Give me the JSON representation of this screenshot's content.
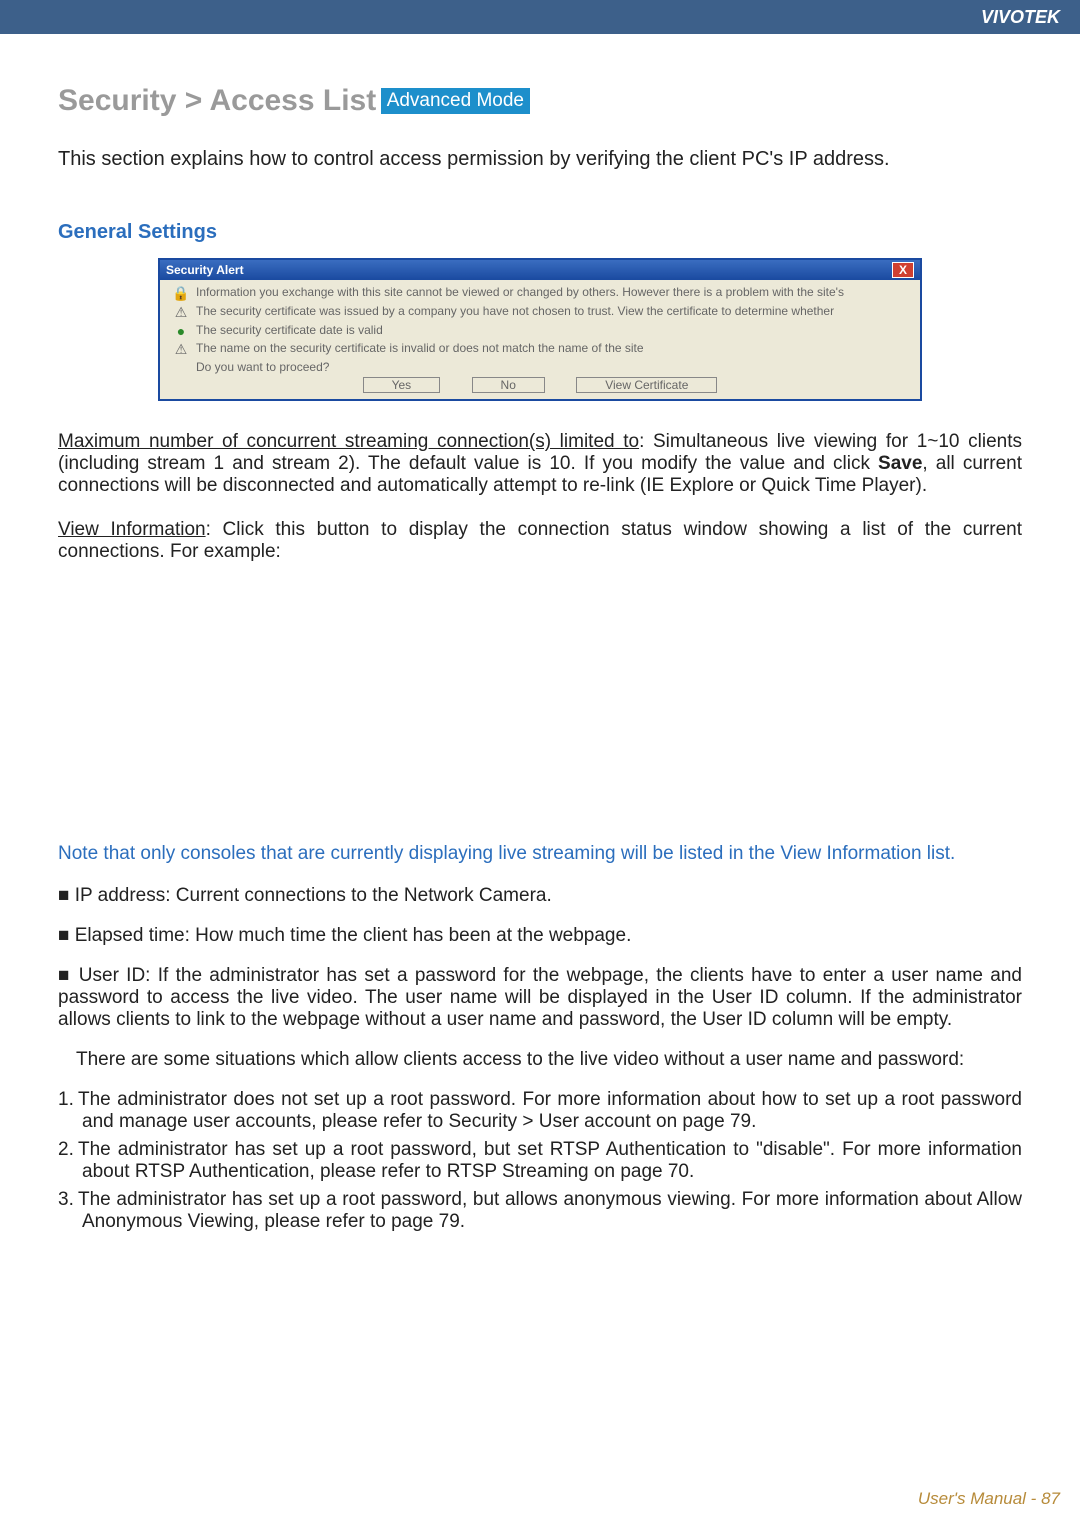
{
  "brand": "VIVOTEK",
  "title_main": "Security  >  Access List",
  "title_badge": "Advanced Mode",
  "intro": "This section explains how to control access permission by verifying the client PC's IP address.",
  "section_general": "General Settings",
  "dialog": {
    "title": "Security Alert",
    "close": "X",
    "line_top": "Information you exchange with this site cannot be viewed or changed by others. However there is a problem with the site's",
    "cert1": "The security certificate was issued by a company you have not chosen to trust. View the certificate to determine whether",
    "cert2": "The security certificate date is valid",
    "cert3": "The name on the security certificate is invalid or does not match the name of the site",
    "prompt": "Do you want to proceed?",
    "btn_yes": "Yes",
    "btn_no": "No",
    "btn_view": "View Certificate"
  },
  "para_max_label": "Maximum number of concurrent streaming connection(s) limited to",
  "para_max_rest": ": Simultaneous live viewing for 1~10 clients (including stream 1 and stream 2). The default value is 10. If you modify the value and click ",
  "para_max_bold": "Save",
  "para_max_tail": ", all current connections will be disconnected and automatically attempt to re-link (IE Explore or Quick Time Player).",
  "para_view_label": "View Information",
  "para_view_rest": ": Click this button to display the connection status window showing a list of the current connections. For example:",
  "note_text": "Note that only consoles that are currently displaying live streaming will be listed in the View Information list.",
  "bul_ip": "■ IP address: Current connections to the Network Camera.",
  "bul_elapsed": "■ Elapsed time: How much time the client has been at the webpage.",
  "bul_user_head": "■ User ID: If the administrator has set a password for the webpage, the clients have to enter a user name and password to access the live video. The user name will be displayed in the User ID column. If  the administrator allows clients to link to the webpage without a user name and password, the User ID column will be empty.",
  "bul_user_situations": "There are some situations which allow clients access to the live video without a user name and password:",
  "num1": "The administrator does not set up a root password. For more information about how to set up a root password and manage user accounts, please refer to Security > User account on page 79.",
  "num2_a": "The administrator has set up a root password, but set ",
  "num2_b": "RTSP Authentication",
  "num2_c": " to \"disable\". For more information about ",
  "num2_d": "RTSP Authentication",
  "num2_e": ", please refer to RTSP Streaming on page 70.",
  "num3_a": "The administrator has set up a root password, but allows anonymous viewing. For more information about ",
  "num3_b": "Allow Anonymous Viewing,",
  "num3_c": " please refer to page 79.",
  "footer_text": "User's Manual - ",
  "footer_page": "87"
}
